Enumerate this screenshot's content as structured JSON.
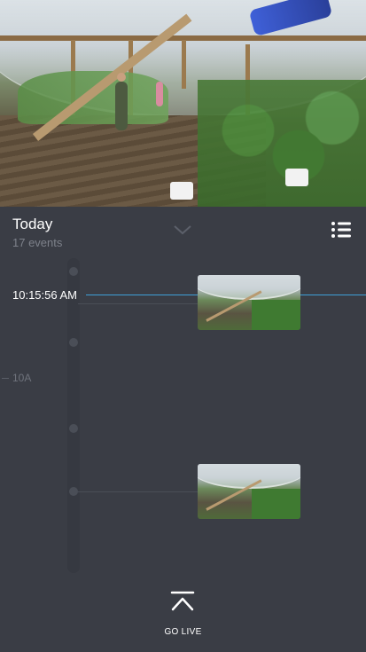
{
  "header": {
    "title": "Today",
    "event_count": "17 events"
  },
  "timeline": {
    "current_time": "10:15:56 AM",
    "hour_label": "10A",
    "accent_color": "#3f9fd8"
  },
  "icons": {
    "collapse": "chevron-down-icon",
    "list": "list-icon",
    "go_live": "arrow-up-to-line-icon"
  },
  "footer": {
    "go_live_label": "GO LIVE"
  }
}
